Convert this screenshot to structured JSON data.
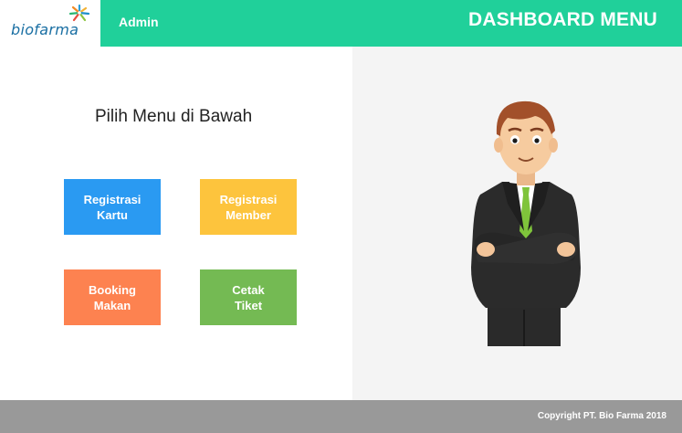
{
  "brand": {
    "logo_text": "biofarma",
    "logo_icon": "biofarma-star-icon"
  },
  "header": {
    "user_label": "Admin",
    "title": "DASHBOARD MENU",
    "accent_color": "#20d09a"
  },
  "main": {
    "prompt": "Pilih Menu di Bawah",
    "menu": [
      {
        "label": "Registrasi\nKartu",
        "color": "#2a9af2"
      },
      {
        "label": "Registrasi\nMember",
        "color": "#fdc43d"
      },
      {
        "label": "Booking\nMakan",
        "color": "#fd8250"
      },
      {
        "label": "Cetak\nTiket",
        "color": "#74ba53"
      }
    ],
    "illustration": "businessman-illustration"
  },
  "footer": {
    "copyright": "Copyright PT. Bio Farma 2018"
  }
}
